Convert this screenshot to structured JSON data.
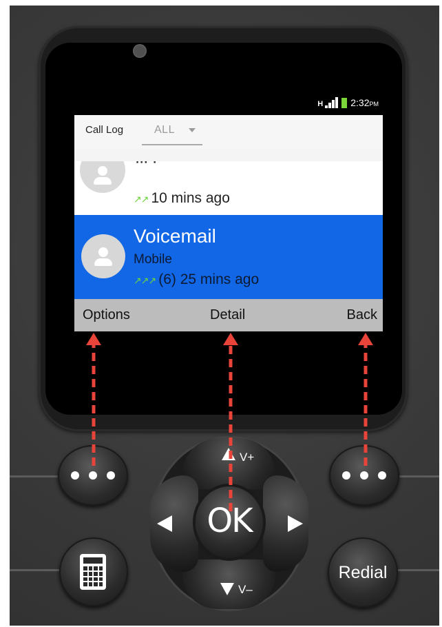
{
  "status_bar": {
    "network": "H",
    "time": "2:32",
    "ampm": "PM",
    "battery_color": "#7bd63a"
  },
  "header": {
    "title": "Call Log",
    "filter_value": "ALL"
  },
  "calls": [
    {
      "name": "",
      "type": "",
      "count": "",
      "time": "10 mins ago",
      "direction_icon": "outgoing-arrows-icon"
    },
    {
      "name": "Voicemail",
      "type": "Mobile",
      "count": "(6)",
      "time": "25 mins ago",
      "direction_icon": "outgoing-arrows-icon",
      "selected": true
    }
  ],
  "softkeys": {
    "left": "Options",
    "center": "Detail",
    "right": "Back"
  },
  "hardware": {
    "ok": "OK",
    "vol_up": "V+",
    "vol_down": "V–",
    "redial": "Redial"
  },
  "colors": {
    "selection": "#1267e6",
    "annotation_arrow": "#e8443a",
    "softkey_bar": "#bcbcbc"
  }
}
